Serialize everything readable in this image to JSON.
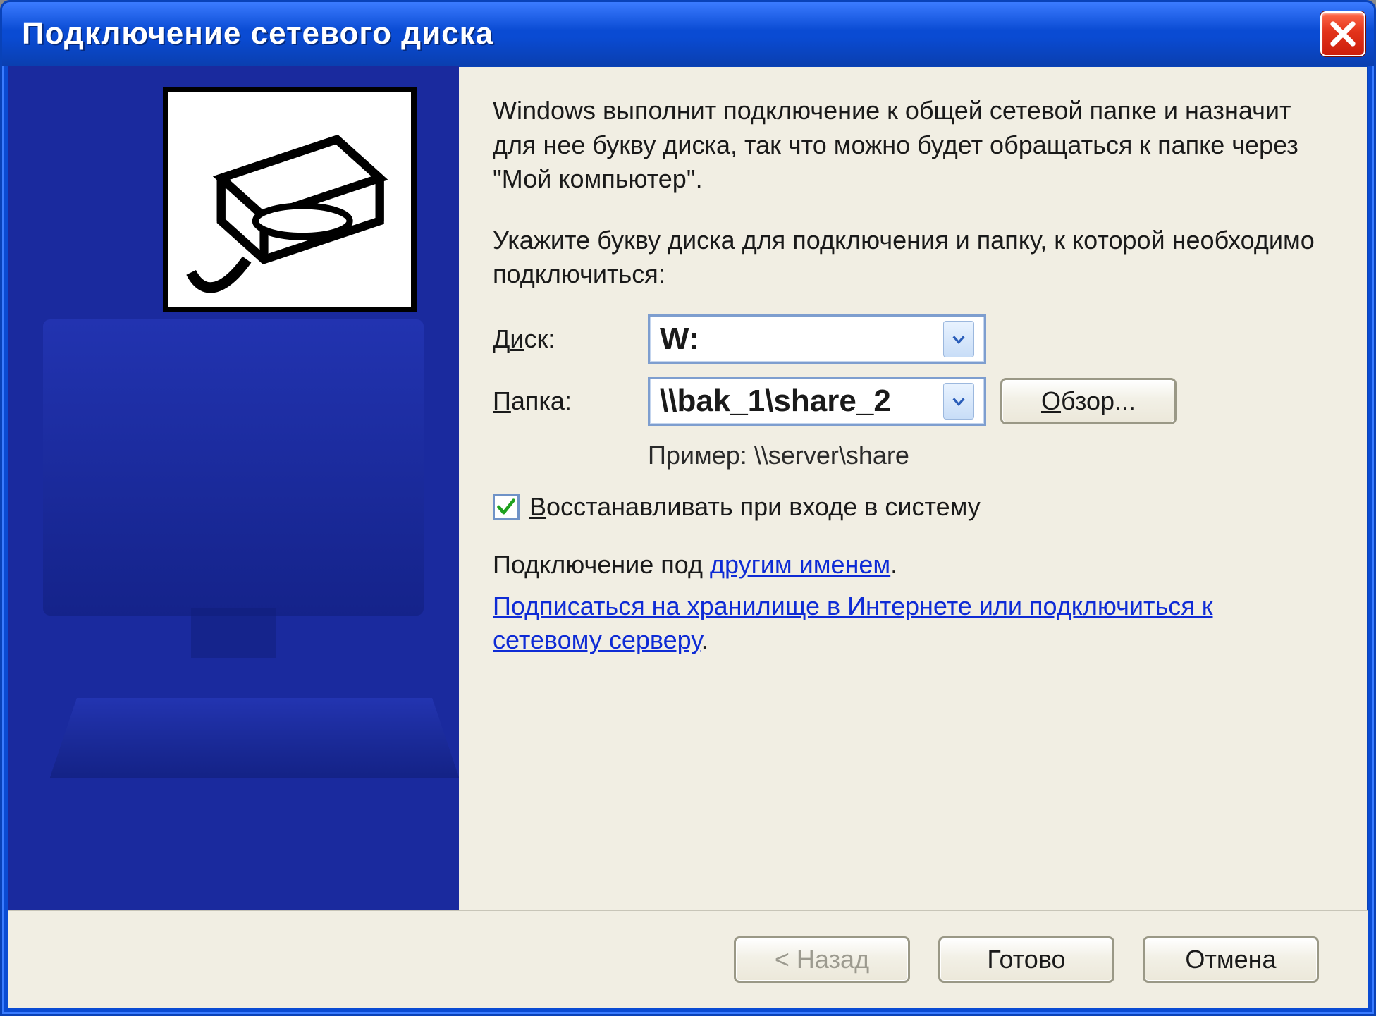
{
  "titlebar": {
    "title": "Подключение сетевого диска"
  },
  "content": {
    "description": "Windows выполнит подключение к общей сетевой папке и назначит для нее букву диска, так что можно будет обращаться к папке через \"Мой компьютер\".",
    "prompt": "Укажите букву диска для подключения и папку, к которой необходимо подключиться:",
    "drive_label_pre": "Д",
    "drive_label_ul": "и",
    "drive_label_post": "ск:",
    "drive_value": "W:",
    "folder_label_ul": "П",
    "folder_label_post": "апка:",
    "folder_value": "\\\\bak_1\\share_2",
    "browse_label_ul": "О",
    "browse_label_post": "бзор...",
    "example": "Пример: \\\\server\\share",
    "reconnect_checked": true,
    "reconnect_ul": "В",
    "reconnect_post": "осстанавливать при входе в систему",
    "altuser_pre": "Подключение под ",
    "altuser_link": "другим именем",
    "signup_link": "Подписаться на хранилище в Интернете или подключиться к сетевому серверу"
  },
  "footer": {
    "back": "< Назад",
    "finish": "Готово",
    "cancel": "Отмена"
  }
}
